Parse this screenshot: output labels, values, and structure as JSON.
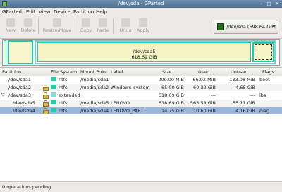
{
  "window": {
    "title": "/dev/sda - GParted",
    "controls": "– □ ✕"
  },
  "menu": [
    "GParted",
    "Edit",
    "View",
    "Device",
    "Partition",
    "Help"
  ],
  "toolbar": {
    "new": "New",
    "delete": "Delete",
    "resize_move": "Resize/Move",
    "copy": "Copy",
    "paste": "Paste",
    "undo": "Undo",
    "apply": "Apply"
  },
  "device": {
    "label": "/dev/sda  (698.64 GiB)",
    "arrow": "▼"
  },
  "diskmap": {
    "main_name": "/dev/sda5",
    "main_size": "618.69 GiB"
  },
  "columns": {
    "partition": "Partition",
    "filesystem": "File System",
    "mount": "Mount Point",
    "label": "Label",
    "size": "Size",
    "used": "Used",
    "unused": "Unused",
    "flags": "Flags"
  },
  "rows": [
    {
      "partition": "/dev/sda1",
      "fs": "ntfs",
      "mount": "/media/sda1",
      "label": "",
      "size": "200.00 MiB",
      "used": "66.92 MiB",
      "unused": "133.08 MiB",
      "flags": "boot"
    },
    {
      "partition": "/dev/sda2",
      "fs": "ntfs",
      "mount": "/media/sda2",
      "label": "Windows_system",
      "size": "65.00 GiB",
      "used": "60.32 GiB",
      "unused": "4.68 GiB",
      "flags": ""
    },
    {
      "partition": "/dev/sda3",
      "fs": "extended",
      "mount": "",
      "label": "",
      "size": "618.69 GiB",
      "used": "---",
      "unused": "---",
      "flags": "lba"
    },
    {
      "partition": "/dev/sda5",
      "fs": "ntfs",
      "mount": "/media/sda5",
      "label": "LENOVO",
      "size": "618.69 GiB",
      "used": "563.58 GiB",
      "unused": "55.11 GiB",
      "flags": ""
    },
    {
      "partition": "/dev/sda4",
      "fs": "ntfs",
      "mount": "/media/sda4",
      "label": "LENOVO_PART",
      "size": "14.75 GiB",
      "used": "10.60 GiB",
      "unused": "4.16 GiB",
      "flags": "diag"
    }
  ],
  "status": "0 operations pending",
  "colors": {
    "ntfs": "#2ec8a3",
    "extended": "#88d8d6",
    "selection": "#9db7d8"
  }
}
